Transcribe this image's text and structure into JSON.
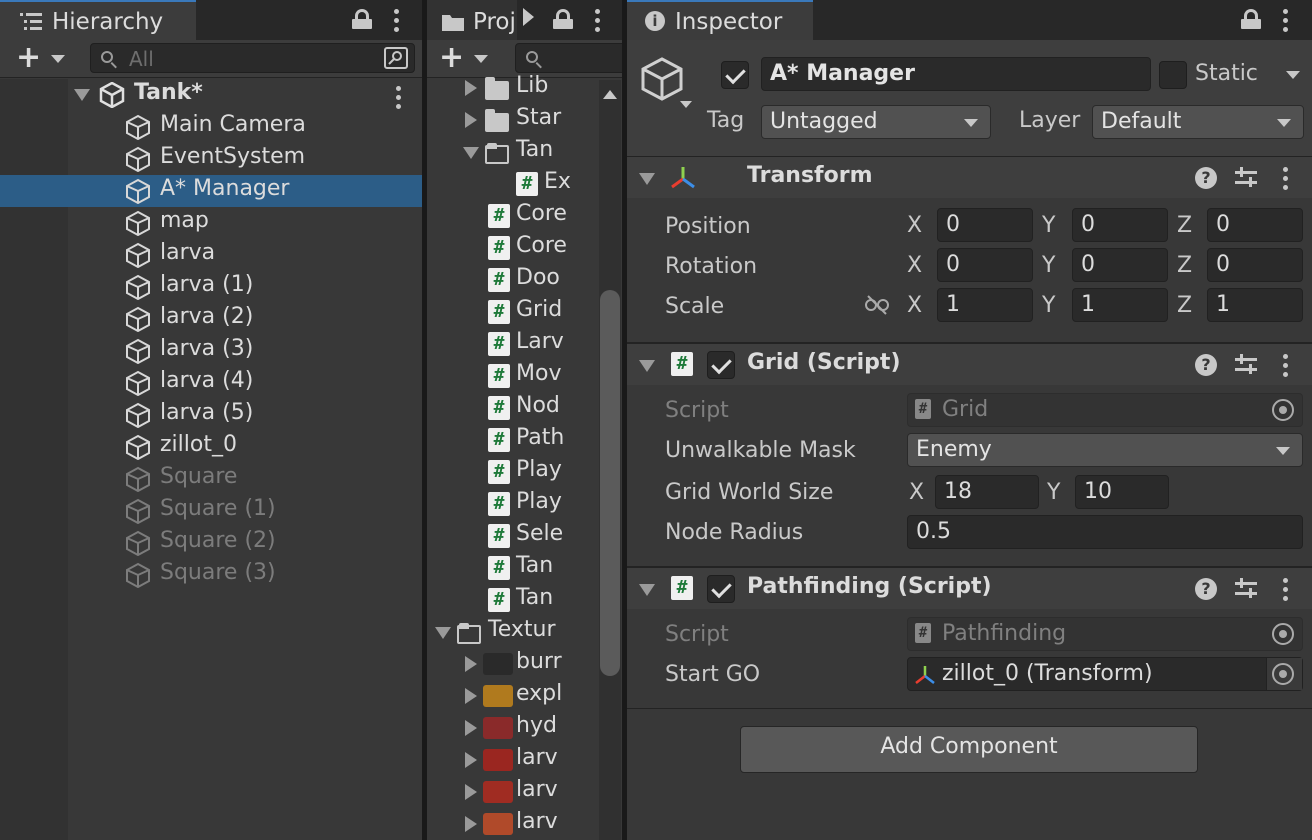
{
  "hierarchy": {
    "tab_label": "Hierarchy",
    "search_placeholder": "All",
    "scene": "Tank*",
    "items": [
      {
        "label": "Main Camera",
        "dim": false,
        "selected": false
      },
      {
        "label": "EventSystem",
        "dim": false,
        "selected": false
      },
      {
        "label": "A* Manager",
        "dim": false,
        "selected": true
      },
      {
        "label": "map",
        "dim": false,
        "selected": false
      },
      {
        "label": "larva",
        "dim": false,
        "selected": false
      },
      {
        "label": "larva (1)",
        "dim": false,
        "selected": false
      },
      {
        "label": "larva (2)",
        "dim": false,
        "selected": false
      },
      {
        "label": "larva (3)",
        "dim": false,
        "selected": false
      },
      {
        "label": "larva (4)",
        "dim": false,
        "selected": false
      },
      {
        "label": "larva (5)",
        "dim": false,
        "selected": false
      },
      {
        "label": "zillot_0",
        "dim": false,
        "selected": false
      },
      {
        "label": "Square",
        "dim": true,
        "selected": false
      },
      {
        "label": "Square (1)",
        "dim": true,
        "selected": false
      },
      {
        "label": "Square (2)",
        "dim": true,
        "selected": false
      },
      {
        "label": "Square (3)",
        "dim": true,
        "selected": false
      }
    ]
  },
  "project": {
    "tab_label": "Proj",
    "items": [
      {
        "label": "Lib",
        "kind": "folder",
        "level": 1,
        "expand": "collapsed"
      },
      {
        "label": "Star",
        "kind": "folder",
        "level": 1,
        "expand": "collapsed"
      },
      {
        "label": "Tan",
        "kind": "folder-open",
        "level": 1,
        "expand": "expanded"
      },
      {
        "label": "Ex",
        "kind": "script",
        "level": 2,
        "expand": "none"
      },
      {
        "label": "Core",
        "kind": "script",
        "level": 1,
        "expand": "none"
      },
      {
        "label": "Core",
        "kind": "script",
        "level": 1,
        "expand": "none"
      },
      {
        "label": "Doo",
        "kind": "script",
        "level": 1,
        "expand": "none"
      },
      {
        "label": "Grid",
        "kind": "script",
        "level": 1,
        "expand": "none"
      },
      {
        "label": "Larv",
        "kind": "script",
        "level": 1,
        "expand": "none"
      },
      {
        "label": "Mov",
        "kind": "script",
        "level": 1,
        "expand": "none"
      },
      {
        "label": "Nod",
        "kind": "script",
        "level": 1,
        "expand": "none"
      },
      {
        "label": "Path",
        "kind": "script",
        "level": 1,
        "expand": "none"
      },
      {
        "label": "Play",
        "kind": "script",
        "level": 1,
        "expand": "none"
      },
      {
        "label": "Play",
        "kind": "script",
        "level": 1,
        "expand": "none"
      },
      {
        "label": "Sele",
        "kind": "script",
        "level": 1,
        "expand": "none"
      },
      {
        "label": "Tan",
        "kind": "script",
        "level": 1,
        "expand": "none"
      },
      {
        "label": "Tan",
        "kind": "script",
        "level": 1,
        "expand": "none"
      },
      {
        "label": "Textur",
        "kind": "folder-open",
        "level": 0,
        "expand": "expanded"
      },
      {
        "label": "burr",
        "kind": "sprite",
        "level": 1,
        "expand": "collapsed",
        "color": "#2a2a2a"
      },
      {
        "label": "expl",
        "kind": "sprite",
        "level": 1,
        "expand": "collapsed",
        "color": "#b07a1e"
      },
      {
        "label": "hyd",
        "kind": "sprite",
        "level": 1,
        "expand": "collapsed",
        "color": "#8a2a2a"
      },
      {
        "label": "larv",
        "kind": "sprite",
        "level": 1,
        "expand": "collapsed",
        "color": "#9a2620"
      },
      {
        "label": "larv",
        "kind": "sprite",
        "level": 1,
        "expand": "collapsed",
        "color": "#a02c22"
      },
      {
        "label": "larv",
        "kind": "sprite",
        "level": 1,
        "expand": "collapsed",
        "color": "#b04a2a"
      }
    ]
  },
  "inspector": {
    "tab_label": "Inspector",
    "object_name": "A* Manager",
    "static_label": "Static",
    "tag_label": "Tag",
    "tag_value": "Untagged",
    "layer_label": "Layer",
    "layer_value": "Default",
    "transform": {
      "title": "Transform",
      "position_label": "Position",
      "rotation_label": "Rotation",
      "scale_label": "Scale",
      "x": "X",
      "y": "Y",
      "z": "Z",
      "position": [
        "0",
        "0",
        "0"
      ],
      "rotation": [
        "0",
        "0",
        "0"
      ],
      "scale": [
        "1",
        "1",
        "1"
      ]
    },
    "grid": {
      "title": "Grid (Script)",
      "script_label": "Script",
      "script_value": "Grid",
      "mask_label": "Unwalkable Mask",
      "mask_value": "Enemy",
      "size_label": "Grid World Size",
      "size_x_label": "X",
      "size_x": "18",
      "size_y_label": "Y",
      "size_y": "10",
      "radius_label": "Node Radius",
      "radius_value": "0.5"
    },
    "pathfinding": {
      "title": "Pathfinding (Script)",
      "script_label": "Script",
      "script_value": "Pathfinding",
      "start_label": "Start GO",
      "start_value": "zillot_0 (Transform)"
    },
    "add_component": "Add Component"
  }
}
